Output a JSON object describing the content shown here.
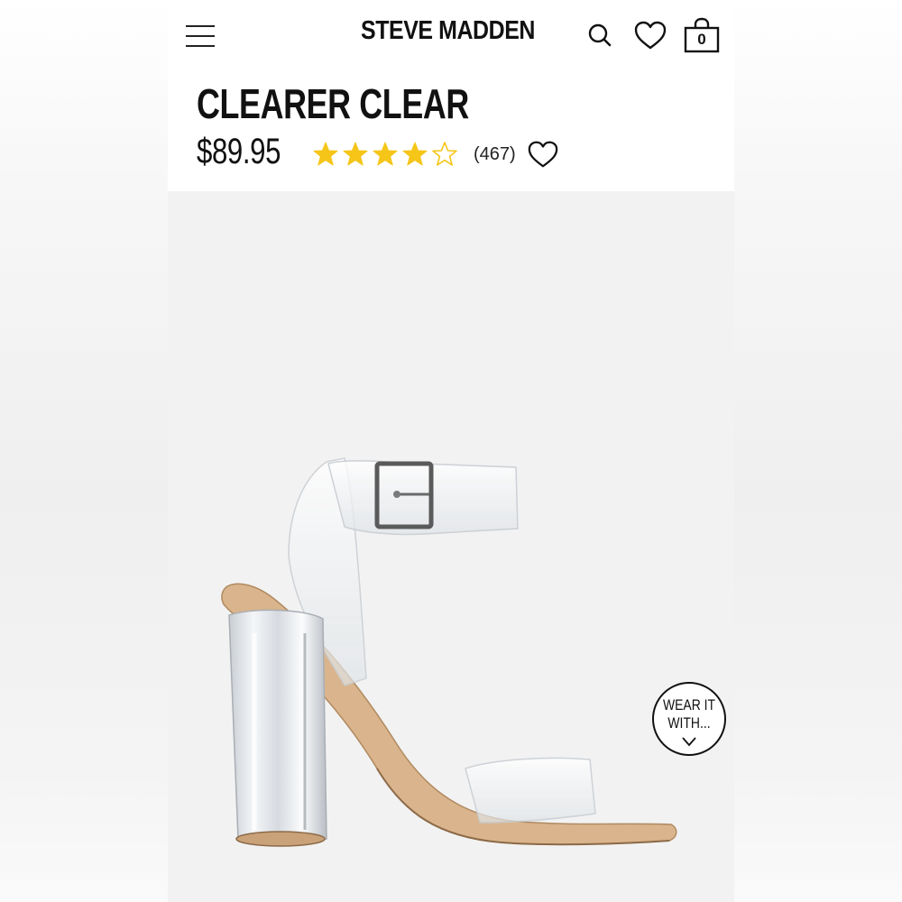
{
  "header": {
    "brand": "STEVE MADDEN",
    "bag_count": "0",
    "icons": [
      "menu-icon",
      "search-icon",
      "heart-icon",
      "shopping-bag-icon"
    ]
  },
  "product": {
    "name": "CLEARER CLEAR",
    "price": "$89.95",
    "rating": 4,
    "rating_max": 5,
    "review_count": "(467)",
    "wear_it_with": "WEAR IT WITH..."
  },
  "colors": {
    "star": "#f5c518",
    "text": "#111111",
    "image_bg": "#f2f2f2",
    "footbed": "#d9b48c"
  }
}
